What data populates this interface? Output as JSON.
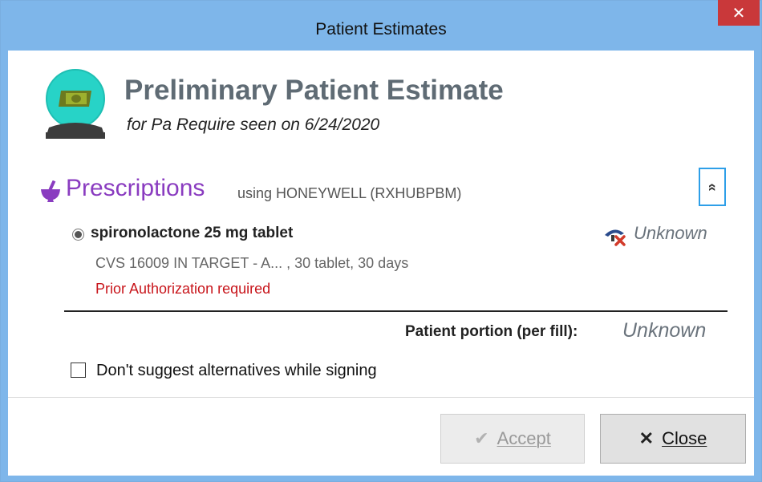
{
  "window": {
    "title": "Patient Estimates",
    "close_glyph": "✕"
  },
  "header": {
    "icon": "crystal-ball-money-icon",
    "title": "Preliminary Patient Estimate",
    "subtitle": "for Pa Require seen on 6/24/2020"
  },
  "section": {
    "icon": "mortar-pestle-icon",
    "title": "Prescriptions",
    "subtitle": "using HONEYWELL (RXHUBPBM)",
    "collapse_glyph": "«"
  },
  "prescription": {
    "name": "spironolactone 25 mg tablet",
    "detail": "CVS 16009 IN TARGET - A... , 30 tablet, 30 days",
    "status": "Prior Authorization required",
    "coverage_icon": "coverage-unknown-icon",
    "coverage_text": "Unknown",
    "status_color": "#c8151b"
  },
  "portion": {
    "label": "Patient portion (per fill):",
    "value": "Unknown"
  },
  "option": {
    "label": "Don't suggest alternatives while signing",
    "checked": false
  },
  "buttons": {
    "accept_glyph": "✔",
    "accept_label": "Accept",
    "close_glyph": "✕",
    "close_label": "Close"
  },
  "colors": {
    "titlebar": "#7eb6ea",
    "accent_purple": "#8a3cc0",
    "close_red": "#c9383a",
    "collapse_border": "#2e9fe8"
  }
}
